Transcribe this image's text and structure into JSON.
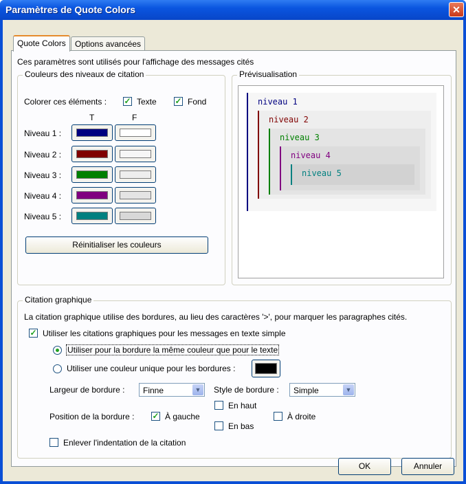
{
  "window": {
    "title": "Paramètres de Quote Colors"
  },
  "tabs": [
    {
      "label": "Quote Colors",
      "active": true
    },
    {
      "label": "Options avancées",
      "active": false
    }
  ],
  "intro": "Ces paramètres sont utilisés pour l'affichage des messages cités",
  "levels_group": {
    "legend": "Couleurs des niveaux de citation",
    "color_items_label": "Colorer ces éléments :",
    "text_check": {
      "label": "Texte",
      "checked": true
    },
    "background_check": {
      "label": "Fond",
      "checked": true
    },
    "col_t": "T",
    "col_f": "F",
    "levels": [
      {
        "label": "Niveau 1 :",
        "text_color": "#000080",
        "bg_color": "#ffffff"
      },
      {
        "label": "Niveau 2 :",
        "text_color": "#800000",
        "bg_color": "#f6f6f6"
      },
      {
        "label": "Niveau 3 :",
        "text_color": "#008000",
        "bg_color": "#eeeeee"
      },
      {
        "label": "Niveau 4 :",
        "text_color": "#800080",
        "bg_color": "#e4e4e4"
      },
      {
        "label": "Niveau 5 :",
        "text_color": "#008080",
        "bg_color": "#d8d8d8"
      }
    ],
    "reset_button": "Réinitialiser les couleurs"
  },
  "preview_group": {
    "legend": "Prévisualisation",
    "lines": [
      "niveau 1",
      "niveau 2",
      "niveau 3",
      "niveau 4",
      "niveau 5"
    ]
  },
  "graphic_group": {
    "legend": "Citation graphique",
    "description": "La citation graphique utilise des bordures, au lieu des caractères '>', pour marquer les paragraphes cités.",
    "use_graphic": {
      "label": "Utiliser les citations graphiques pour les messages en texte simple",
      "checked": true
    },
    "radio_same": {
      "label": "Utiliser pour la bordure la même couleur que pour le texte",
      "selected": true
    },
    "radio_unique": {
      "label": "Utiliser une couleur unique pour les bordures :",
      "selected": false,
      "color": "#000000"
    },
    "width_label": "Largeur de bordure :",
    "width_value": "Finne",
    "style_label": "Style de bordure :",
    "style_value": "Simple",
    "position_label": "Position de la bordure :",
    "pos_left": {
      "label": "À gauche",
      "checked": true
    },
    "pos_top": {
      "label": "En haut",
      "checked": false
    },
    "pos_bottom": {
      "label": "En bas",
      "checked": false
    },
    "pos_right": {
      "label": "À droite",
      "checked": false
    },
    "remove_indent": {
      "label": "Enlever l'indentation de la citation",
      "checked": false
    }
  },
  "buttons": {
    "ok": "OK",
    "cancel": "Annuler"
  }
}
